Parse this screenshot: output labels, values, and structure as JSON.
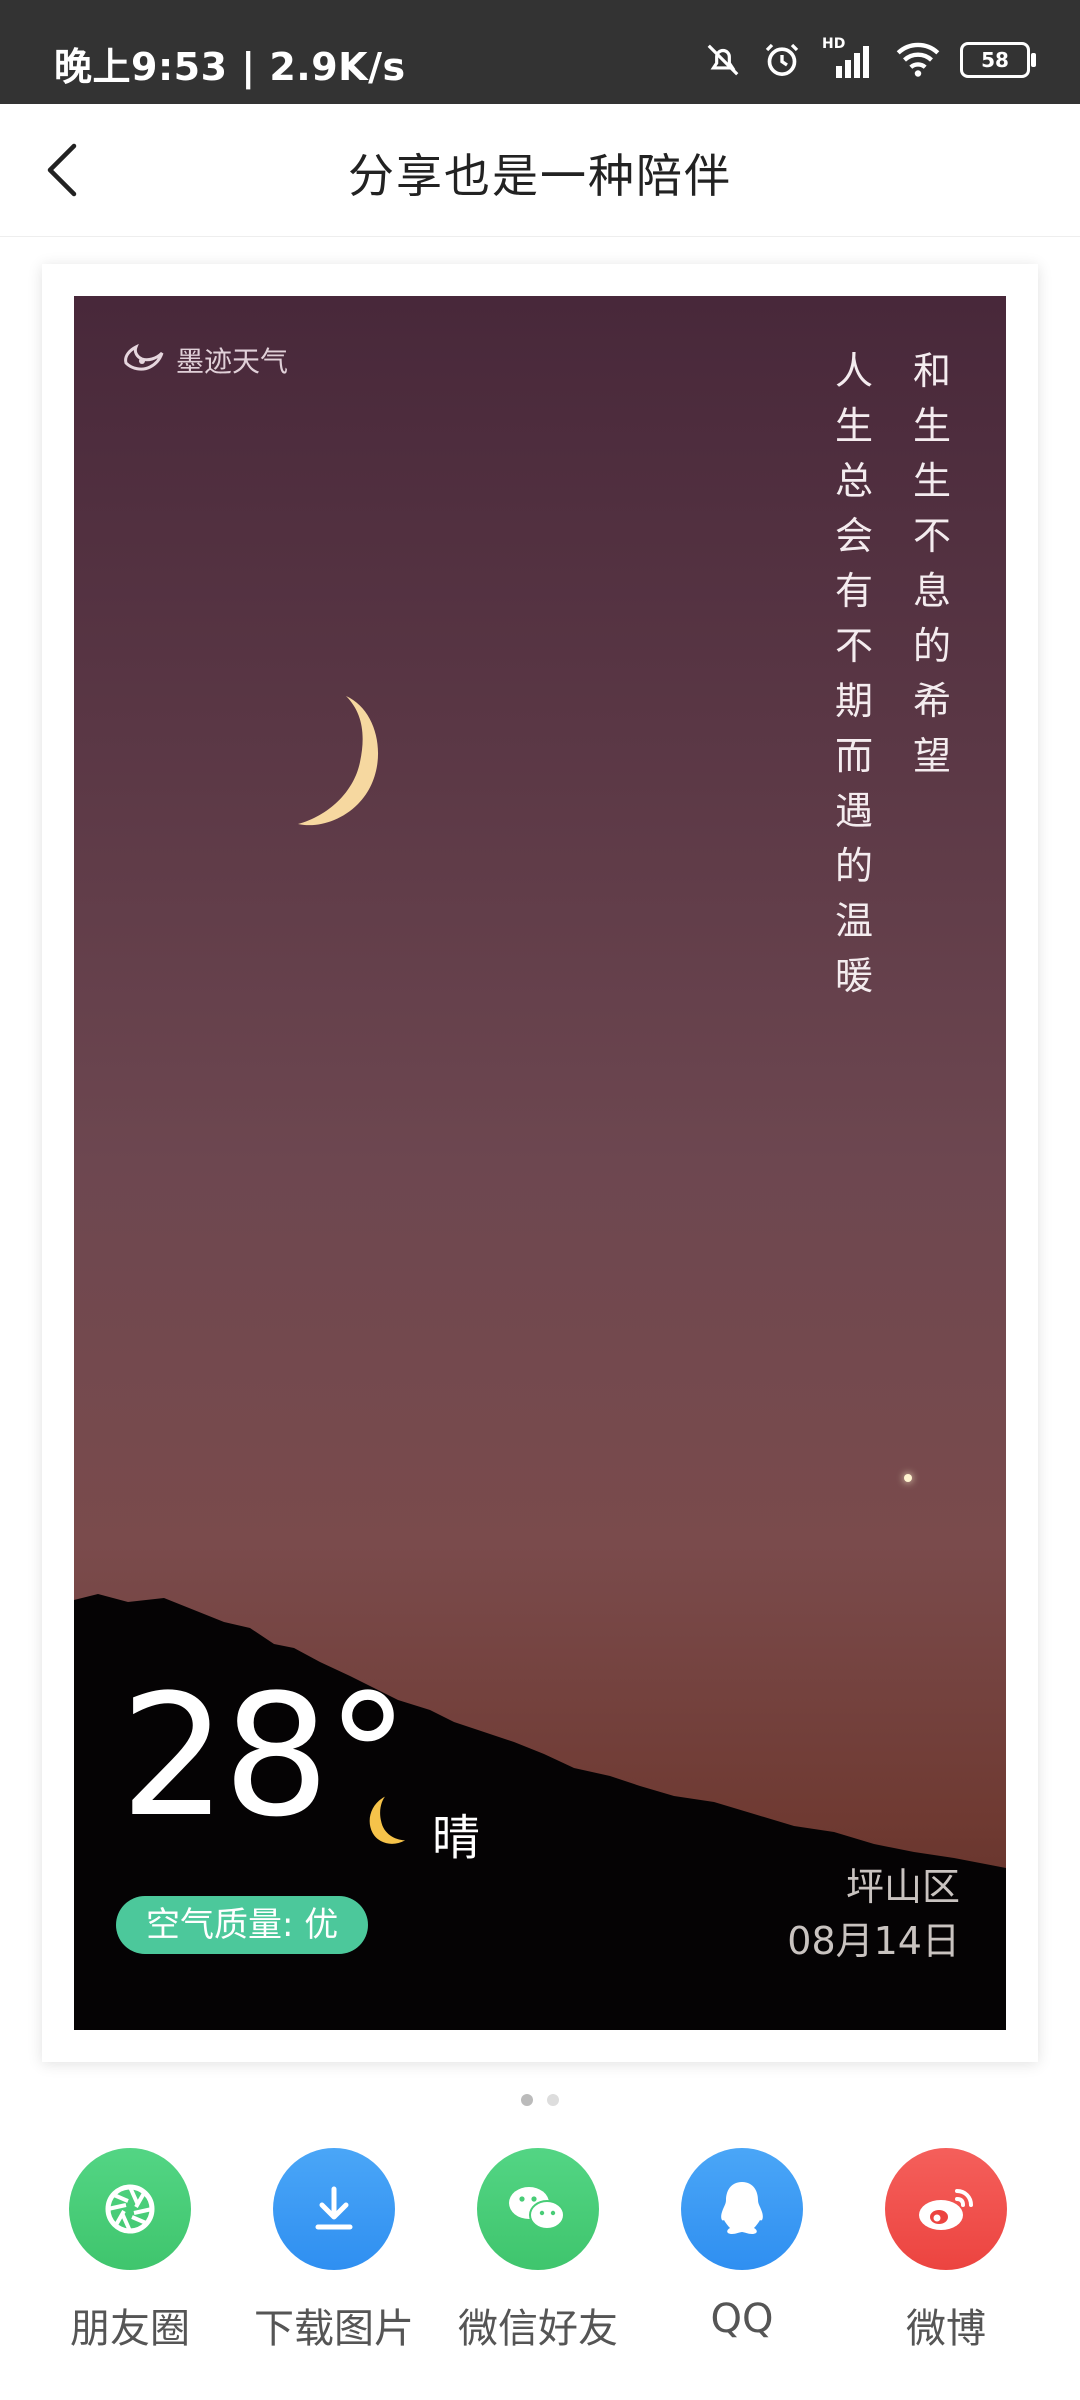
{
  "status_bar": {
    "time_speed": "晚上9:53 | 2.9K/s",
    "battery": "58",
    "signal_label": "HD"
  },
  "header": {
    "title": "分享也是一种陪伴"
  },
  "card": {
    "brand": "墨迹天气",
    "poem_columns": [
      "和生生不息的希望",
      "人生总会有不期而遇的温暖"
    ],
    "temperature": "28°",
    "condition": "晴",
    "air_quality": "空气质量: 优",
    "district": "坪山区",
    "date": "08月14日"
  },
  "pager": {
    "active_index": 0,
    "count": 2
  },
  "share": [
    {
      "label": "朋友圈",
      "icon": "moments-icon",
      "color": "#4dd07a"
    },
    {
      "label": "下载图片",
      "icon": "download-icon",
      "color": "#3b9cf5"
    },
    {
      "label": "微信好友",
      "icon": "wechat-icon",
      "color": "#4dd07a"
    },
    {
      "label": "QQ",
      "icon": "qq-icon",
      "color": "#3b9cf5"
    },
    {
      "label": "微博",
      "icon": "weibo-icon",
      "color": "#f0524f"
    }
  ]
}
